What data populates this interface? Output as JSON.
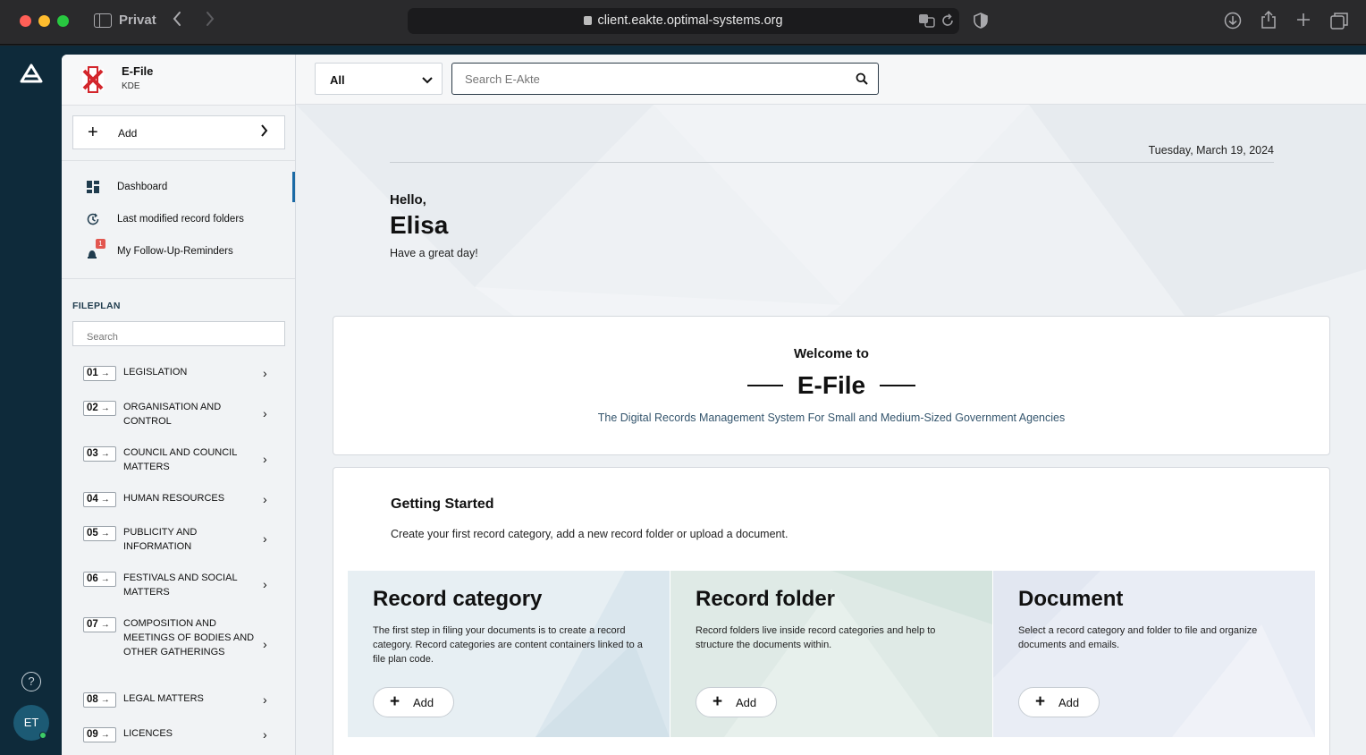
{
  "browser": {
    "profile_label": "Privat",
    "url": "client.eakte.optimal-systems.org"
  },
  "rail": {
    "help_label": "?",
    "avatar_initials": "ET"
  },
  "brand": {
    "name": "E-File",
    "subtitle": "KDE"
  },
  "sidebar": {
    "add_label": "Add",
    "nav": [
      {
        "label": "Dashboard",
        "active": true
      },
      {
        "label": "Last modified record folders",
        "active": false
      },
      {
        "label": "My Follow-Up-Reminders",
        "active": false,
        "badge": "1"
      }
    ],
    "fileplan_title": "FILEPLAN",
    "fileplan_search_placeholder": "Search",
    "fileplan": [
      {
        "code": "01",
        "label": "LEGISLATION"
      },
      {
        "code": "02",
        "label": "ORGANISATION AND CONTROL"
      },
      {
        "code": "03",
        "label": "COUNCIL AND COUNCIL MATTERS"
      },
      {
        "code": "04",
        "label": "HUMAN RESOURCES"
      },
      {
        "code": "05",
        "label": "PUBLICITY AND INFORMATION"
      },
      {
        "code": "06",
        "label": "FESTIVALS AND SOCIAL MATTERS"
      },
      {
        "code": "07",
        "label": "COMPOSITION AND MEETINGS OF BODIES AND OTHER GATHERINGS"
      },
      {
        "code": "08",
        "label": "LEGAL MATTERS"
      },
      {
        "code": "09",
        "label": "LICENCES"
      }
    ]
  },
  "topbar": {
    "scope_value": "All",
    "search_placeholder": "Search E-Akte"
  },
  "dashboard": {
    "date": "Tuesday, March 19, 2024",
    "hello": "Hello,",
    "user_name": "Elisa",
    "greeting": "Have a great day!",
    "welcome": {
      "heading": "Welcome to",
      "title": "E-File",
      "subtitle": "The Digital Records Management System For Small and Medium-Sized Government Agencies"
    },
    "getting_started": {
      "title": "Getting Started",
      "description": "Create your first record category, add a new record folder or upload a document.",
      "tiles": [
        {
          "title": "Record category",
          "description": "The first step in filing your documents is to create a record category. Record categories are content containers linked to a file plan code.",
          "button": "Add"
        },
        {
          "title": "Record folder",
          "description": "Record folders live inside record categories and help to structure the documents within.",
          "button": "Add"
        },
        {
          "title": "Document",
          "description": "Select a record category and folder to file and organize documents and emails.",
          "button": "Add"
        }
      ]
    }
  },
  "colors": {
    "rail": "#0e2a3a",
    "accent": "#1b6aa5",
    "badge": "#e2564f"
  }
}
